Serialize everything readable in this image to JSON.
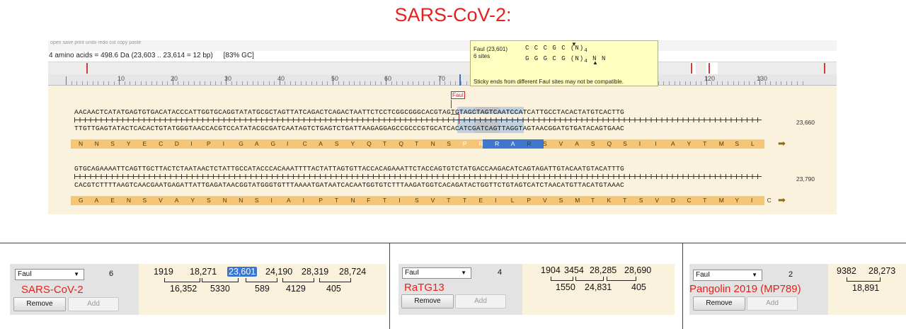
{
  "title": "SARS-CoV-2:",
  "menu_strip": "open    save    print    undo    redo    cut    copy    paste",
  "info": {
    "amino": "4 amino acids  =  498.6 Da (23,603 .. 23,614 = 12 bp)",
    "gc": "[83% GC]"
  },
  "ruler": [
    "10",
    "20",
    "30",
    "40",
    "50",
    "60",
    "70",
    "120",
    "130"
  ],
  "tooltip": {
    "enzyme": "FauI  (23,601)",
    "sites": "6 sites",
    "top_site": "C C C G C (N)",
    "top_sub": "4",
    "bottom_site": "G G G C G (N)",
    "bottom_sub": "4",
    "bottom_tail": "N N",
    "note": "Sticky ends from different FauI sites may not be compatible."
  },
  "enzyme_tag": "FauI",
  "blocks": [
    {
      "top": "AACAACTCATATGAGTGTGACATACCCATTGGTGCAGGTATATGCGCTAGTTATCAGACTCAGACTAATTCTCCTCGGCGGGCACGTAGTGTAGCTAGTCAATCCATCATTGCCTACACTATGTCACTTG",
      "bottom": "TTGTTGAGTATACTCACACTGTATGGGTAACCACGTCCATATACGCGATCAATAGTCTGAGTCTGATTAAGAGGAGCCGCCCGTGCATCACATCGATCAGTTAGGTAGTAACGGATGTGATACAGTGAAC",
      "aa": [
        "N",
        "N",
        "S",
        "Y",
        "E",
        "C",
        "D",
        "I",
        "P",
        "I",
        "G",
        "A",
        "G",
        "I",
        "C",
        "A",
        "S",
        "Y",
        "Q",
        "T",
        "Q",
        "T",
        "N",
        "S",
        "P",
        "R",
        "R",
        "A",
        "R",
        "S",
        "V",
        "A",
        "S",
        "Q",
        "S",
        "I",
        "I",
        "A",
        "Y",
        "T",
        "M",
        "S",
        "L"
      ],
      "position": "23,660"
    },
    {
      "top": "GTGCAGAAAATTCAGTTGCTTACTCTAATAACTCTATTGCCATACCCACAAATTTTACTATTAGTGTTACCACAGAAATTCTACCAGTGTCTATGACCAAGACATCAGTAGATTGTACAATGTACATTTG",
      "bottom": "CACGTCTTTTAAGTCAACGAATGAGATTATTGAGATAACGGTATGGGTGTTTAAAATGATAATCACAATGGTGTCTTTAAGATGGTCACAGATACTGGTTCTGTAGTCATCTAACATGTTACATGTAAAC",
      "aa": [
        "G",
        "A",
        "E",
        "N",
        "S",
        "V",
        "A",
        "Y",
        "S",
        "N",
        "N",
        "S",
        "I",
        "A",
        "I",
        "P",
        "T",
        "N",
        "F",
        "T",
        "I",
        "S",
        "V",
        "T",
        "T",
        "E",
        "I",
        "L",
        "P",
        "V",
        "S",
        "M",
        "T",
        "K",
        "T",
        "S",
        "V",
        "D",
        "C",
        "T",
        "M",
        "Y",
        "I",
        "C"
      ],
      "position": "23,790"
    }
  ],
  "panels": [
    {
      "enzyme": "FauI",
      "count": "6",
      "organism": "SARS-CoV-2",
      "remove": "Remove",
      "add": "Add",
      "sites": [
        "1919",
        "18,271",
        "23,601",
        "24,190",
        "28,319",
        "28,724"
      ],
      "fragments": [
        "16,352",
        "5330",
        "589",
        "4129",
        "405"
      ],
      "selected_site": "23,601"
    },
    {
      "enzyme": "FauI",
      "count": "4",
      "organism": "RaTG13",
      "remove": "Remove",
      "add": "Add",
      "sites": [
        "1904",
        "3454",
        "28,285",
        "28,690"
      ],
      "fragments": [
        "1550",
        "24,831",
        "405"
      ]
    },
    {
      "enzyme": "FauI",
      "count": "2",
      "organism": "Pangolin 2019 (MP789)",
      "remove": "Remove",
      "add": "Add",
      "sites": [
        "9382",
        "28,273"
      ],
      "fragments": [
        "18,891"
      ]
    }
  ],
  "colors": {
    "title": "#e8201c",
    "background_seq": "#fbf2de",
    "aa_bar": "#f7c576",
    "selection": "#3874d4",
    "enzyme_red": "#d81b1b"
  }
}
